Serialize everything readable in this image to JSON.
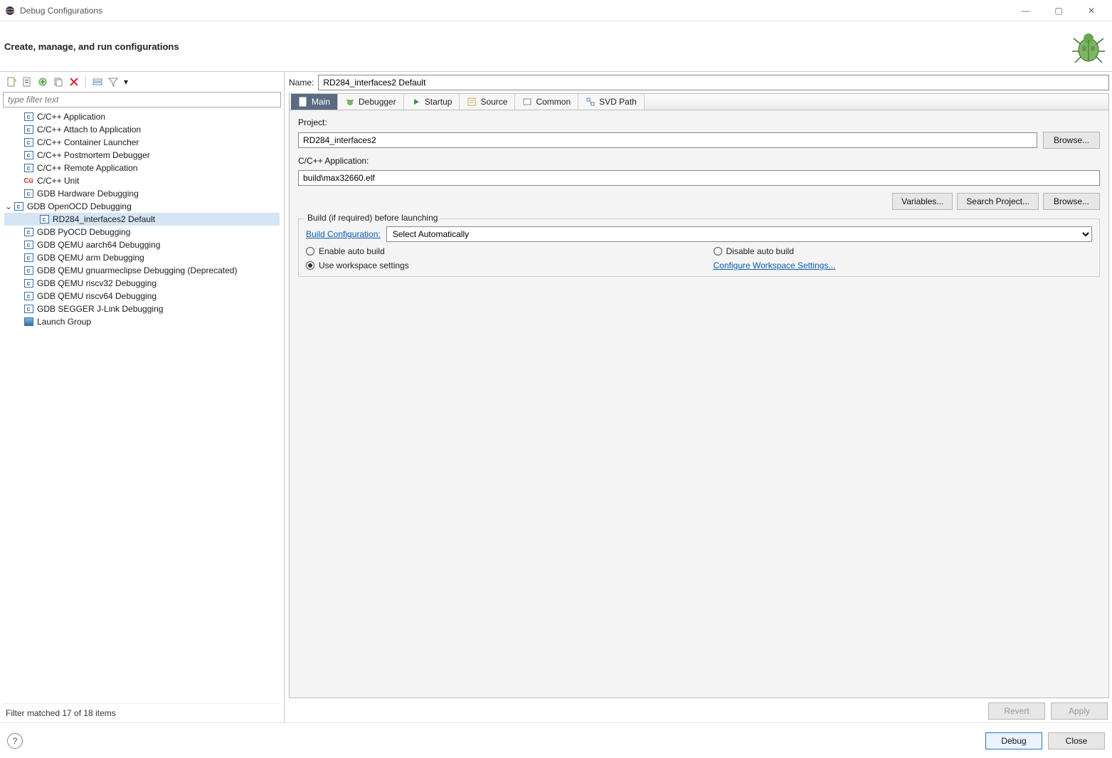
{
  "window": {
    "title": "Debug Configurations",
    "banner_title": "Create, manage, and run configurations"
  },
  "left": {
    "filter_placeholder": "type filter text",
    "items": [
      "C/C++ Application",
      "C/C++ Attach to Application",
      "C/C++ Container Launcher",
      "C/C++ Postmortem Debugger",
      "C/C++ Remote Application",
      "C/C++ Unit",
      "GDB Hardware Debugging",
      "GDB OpenOCD Debugging",
      "RD284_interfaces2 Default",
      "GDB PyOCD Debugging",
      "GDB QEMU aarch64 Debugging",
      "GDB QEMU arm Debugging",
      "GDB QEMU gnuarmeclipse Debugging (Deprecated)",
      "GDB QEMU riscv32 Debugging",
      "GDB QEMU riscv64 Debugging",
      "GDB SEGGER J-Link Debugging",
      "Launch Group"
    ],
    "status": "Filter matched 17 of 18 items"
  },
  "right": {
    "name_label": "Name:",
    "name_value": "RD284_interfaces2 Default",
    "tabs": [
      "Main",
      "Debugger",
      "Startup",
      "Source",
      "Common",
      "SVD Path"
    ],
    "project_label": "Project:",
    "project_value": "RD284_interfaces2",
    "app_label": "C/C++ Application:",
    "app_value": "build\\max32660.elf",
    "btn_variables": "Variables...",
    "btn_search_project": "Search Project...",
    "btn_browse": "Browse...",
    "group_title": "Build (if required) before launching",
    "build_conf_label": "Build Configuration:",
    "build_conf_value": "Select Automatically",
    "radio_enable_auto": "Enable auto build",
    "radio_disable_auto": "Disable auto build",
    "radio_workspace": "Use workspace settings",
    "link_configure": "Configure Workspace Settings...",
    "btn_revert": "Revert",
    "btn_apply": "Apply"
  },
  "footer": {
    "btn_debug": "Debug",
    "btn_close": "Close"
  }
}
